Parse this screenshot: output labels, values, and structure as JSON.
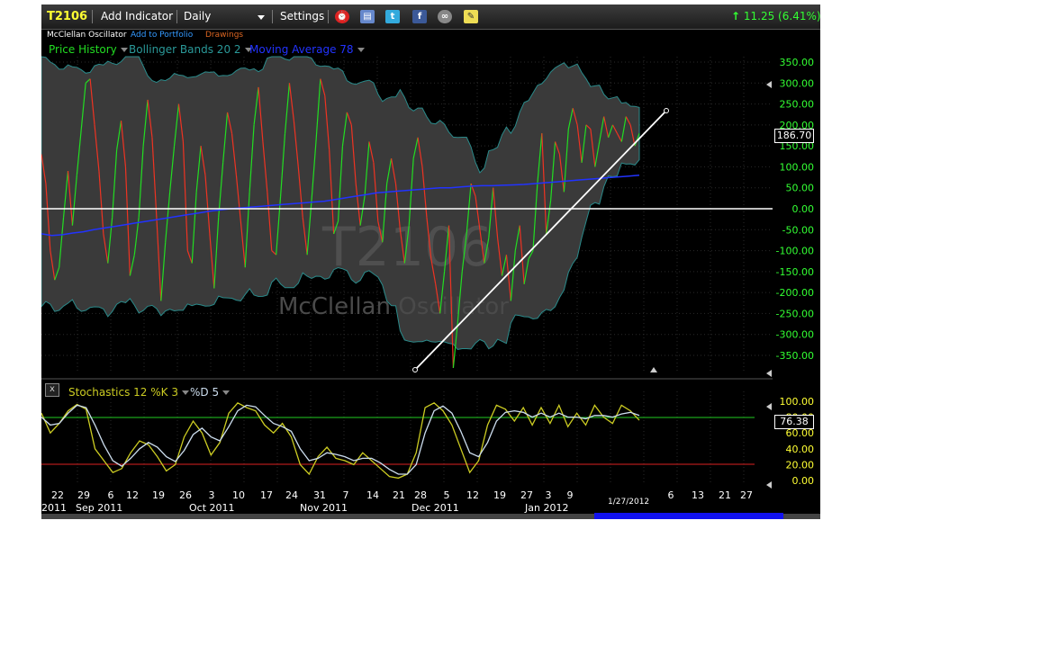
{
  "toolbar": {
    "symbol": "T2106",
    "add_indicator": "Add Indicator",
    "period": "Daily",
    "settings": "Settings",
    "change": "11.25 (6.41%)"
  },
  "subheader": {
    "title": "McClellan Oscillator",
    "add_to_portfolio": "Add to Portfolio",
    "drawings": "Drawings"
  },
  "indicators": {
    "price_history": "Price History",
    "bollinger": "Bollinger Bands 20 2",
    "moving_average": "Moving Average 78"
  },
  "watermark": {
    "symbol": "T2106",
    "name": "McClellan Oscillator"
  },
  "lower_panel": {
    "close_label": "x",
    "stochastics": "Stochastics 12 %K 3",
    "d_label": "%D 5"
  },
  "x_axis": {
    "day_ticks": [
      "22",
      "29",
      "6",
      "12",
      "19",
      "26",
      "3",
      "10",
      "17",
      "24",
      "31",
      "7",
      "14",
      "21",
      "28",
      "5",
      "12",
      "19",
      "27",
      "3",
      "9",
      "6",
      "13",
      "21",
      "27"
    ],
    "month_labels": [
      "2011",
      "Sep 2011",
      "Oct 2011",
      "Nov 2011",
      "Dec 2011",
      "Jan 2012"
    ],
    "crosshair_date": "1/27/2012"
  },
  "chart_data": [
    {
      "type": "line",
      "series": [
        {
          "name": "Price History",
          "color": "#22dd22",
          "alt_color": "#ee3322",
          "values": [
            130,
            60,
            -100,
            -170,
            -140,
            -20,
            90,
            -40,
            80,
            190,
            300,
            310,
            200,
            90,
            -60,
            -130,
            -20,
            140,
            210,
            100,
            -160,
            -110,
            -20,
            150,
            260,
            170,
            -20,
            -220,
            -80,
            40,
            150,
            250,
            160,
            -100,
            -130,
            40,
            150,
            80,
            -60,
            -190,
            -20,
            110,
            230,
            180,
            80,
            -30,
            -140,
            40,
            200,
            290,
            160,
            40,
            -100,
            -110,
            30,
            180,
            300,
            210,
            100,
            -20,
            -110,
            20,
            160,
            310,
            270,
            140,
            -60,
            -30,
            150,
            230,
            200,
            60,
            -40,
            30,
            160,
            110,
            -30,
            -80,
            60,
            120,
            60,
            -50,
            -130,
            -40,
            120,
            170,
            100,
            -20,
            -120,
            -180,
            -250,
            -150,
            -40,
            -380,
            -270,
            -150,
            -60,
            60,
            30,
            -50,
            -130,
            -70,
            50,
            -70,
            -160,
            -110,
            -220,
            -100,
            -40,
            -180,
            -120,
            -100,
            60,
            180,
            -60,
            20,
            160,
            130,
            40,
            190,
            240,
            200,
            110,
            200,
            190,
            100,
            160,
            220,
            170,
            200,
            180,
            160,
            220,
            200,
            150,
            180
          ]
        },
        {
          "name": "Moving Average 78",
          "color": "#2233ff",
          "values": [
            -60,
            -64,
            -62,
            -58,
            -55,
            -50,
            -46,
            -42,
            -38,
            -34,
            -30,
            -26,
            -22,
            -18,
            -14,
            -10,
            -6,
            -3,
            0,
            2,
            4,
            6,
            8,
            10,
            12,
            14,
            16,
            18,
            22,
            26,
            30,
            34,
            38,
            40,
            42,
            44,
            46,
            48,
            50,
            50,
            52,
            54,
            55,
            55,
            56,
            57,
            58,
            60,
            62,
            64,
            66,
            68,
            70,
            72,
            74,
            76,
            78,
            80
          ]
        }
      ],
      "bollinger_bands": {
        "name": "Bollinger Bands 20 2"
      },
      "ylim": [
        -390,
        370
      ],
      "y_ticks": [
        "350.00",
        "300.00",
        "250.00",
        "200.00",
        "150.00",
        "100.00",
        "50.00",
        "0.00",
        "-50.00",
        "-100.00",
        "-150.00",
        "-200.00",
        "-250.00",
        "-300.00",
        "-350.00"
      ],
      "last_value": "186.70",
      "grid": true
    },
    {
      "type": "line",
      "series": [
        {
          "name": "Stochastics 12 %K 3",
          "color": "#cccc22",
          "values": [
            85,
            60,
            72,
            88,
            96,
            90,
            40,
            25,
            10,
            15,
            35,
            50,
            45,
            30,
            12,
            20,
            55,
            75,
            60,
            32,
            48,
            85,
            98,
            92,
            88,
            70,
            60,
            72,
            55,
            20,
            8,
            30,
            42,
            28,
            25,
            20,
            35,
            25,
            15,
            5,
            3,
            8,
            35,
            92,
            98,
            88,
            70,
            40,
            10,
            25,
            70,
            95,
            90,
            75,
            92,
            70,
            92,
            72,
            95,
            68,
            85,
            70,
            95,
            80,
            72,
            95,
            88,
            76
          ]
        },
        {
          "name": "%D 5",
          "color": "#ccddee",
          "values": [
            80,
            70,
            72,
            85,
            95,
            92,
            70,
            45,
            25,
            18,
            28,
            40,
            48,
            42,
            30,
            24,
            38,
            58,
            66,
            55,
            50,
            68,
            88,
            95,
            93,
            82,
            72,
            68,
            62,
            40,
            25,
            28,
            35,
            33,
            30,
            25,
            28,
            28,
            22,
            14,
            8,
            8,
            20,
            60,
            88,
            94,
            85,
            62,
            35,
            30,
            48,
            75,
            86,
            88,
            86,
            80,
            85,
            80,
            85,
            80,
            80,
            78,
            82,
            82,
            80,
            84,
            86,
            82
          ]
        }
      ],
      "ylim": [
        0,
        100
      ],
      "y_ticks": [
        "100.00",
        "80.00",
        "60.00",
        "40.00",
        "20.00",
        "0.00"
      ],
      "reference_lines": [
        80,
        20
      ],
      "last_value": "76.38",
      "grid": true
    }
  ],
  "colors": {
    "accent_green": "#22dd22",
    "accent_red": "#ee3322",
    "axis_text": "#33ff33",
    "band_fill": "#3a3a3a",
    "band_edge": "#2a8a8a"
  }
}
